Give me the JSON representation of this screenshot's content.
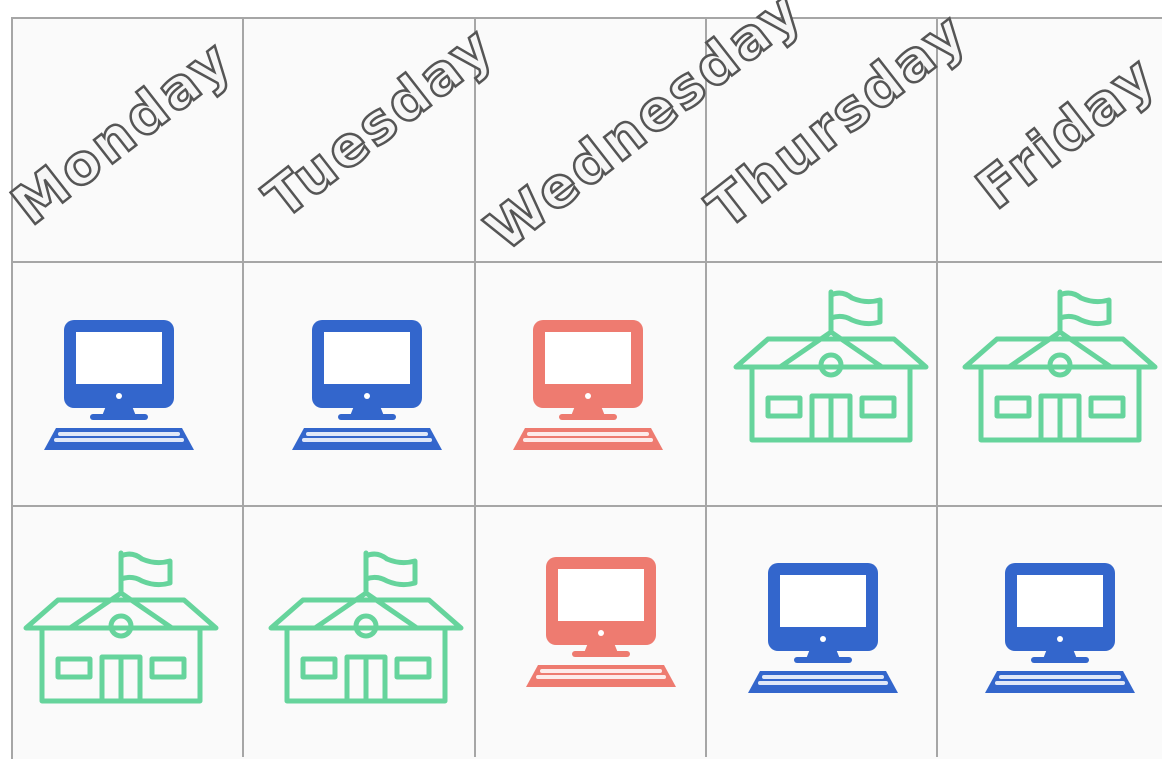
{
  "days": [
    "Monday",
    "Tuesday",
    "Wednesday",
    "Thursday",
    "Friday"
  ],
  "schedule": [
    [
      "computer",
      "computer",
      "computer",
      "school",
      "school"
    ],
    [
      "school",
      "school",
      "computer",
      "computer",
      "computer"
    ]
  ],
  "colors": {
    "computer_blue": "#3366cc",
    "computer_red": "#ee7b70",
    "school_green": "#66d49c",
    "grid_line": "#a6a6a6",
    "header_text_outline": "#555555"
  },
  "icon_colors": [
    [
      "blue",
      "blue",
      "red",
      "green",
      "green"
    ],
    [
      "green",
      "green",
      "red",
      "blue",
      "blue"
    ]
  ]
}
